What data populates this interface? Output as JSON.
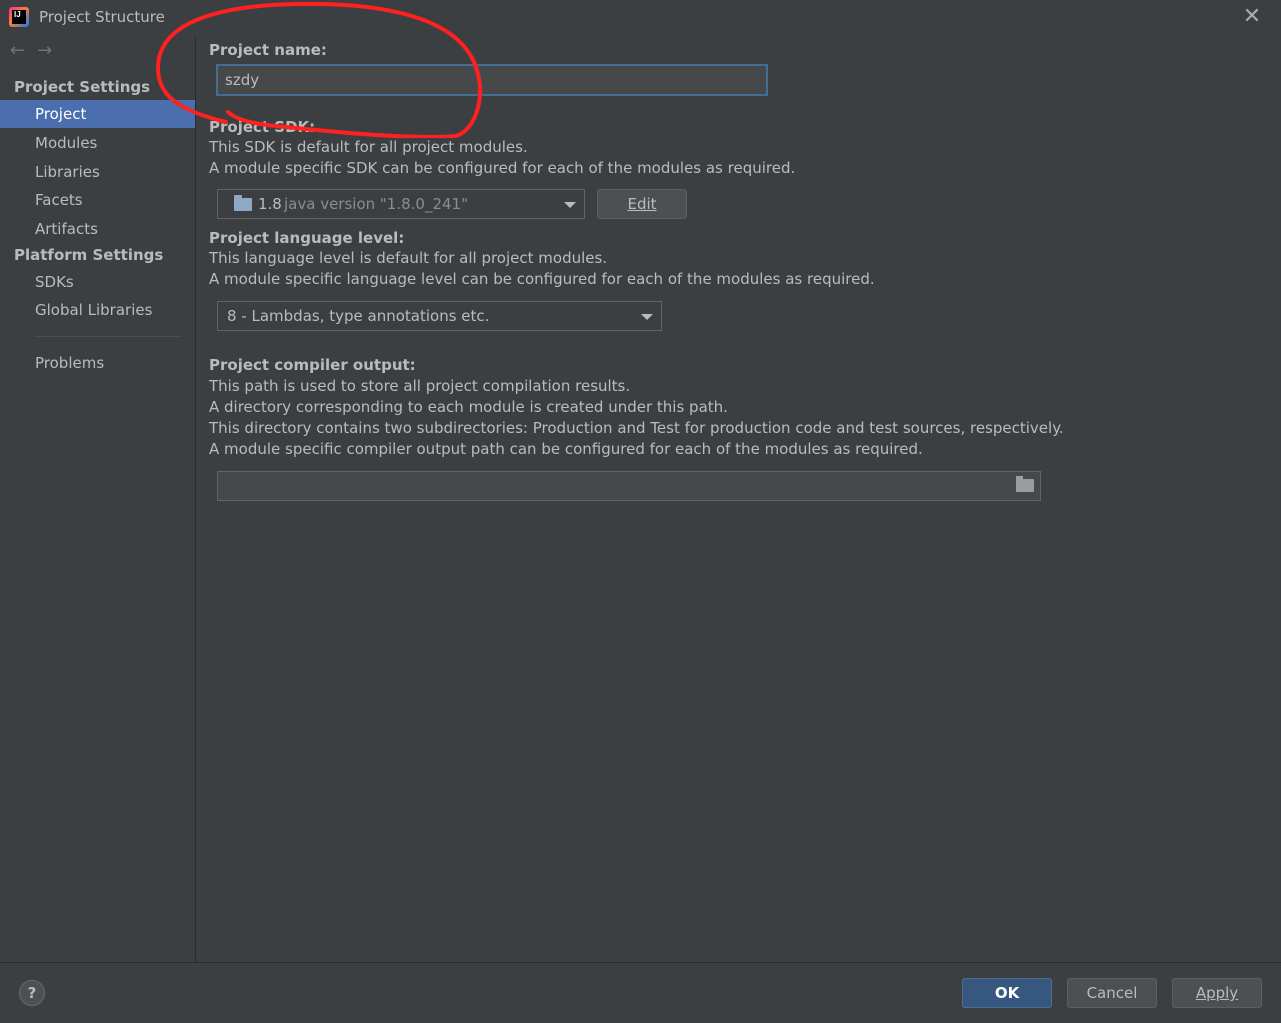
{
  "window": {
    "title": "Project Structure",
    "close_glyph": "✕",
    "app_icon_text": "IJ"
  },
  "nav": {
    "back": "←",
    "forward": "→"
  },
  "sidebar": {
    "project_settings_header": "Project Settings",
    "project_settings_items": [
      "Project",
      "Modules",
      "Libraries",
      "Facets",
      "Artifacts"
    ],
    "platform_settings_header": "Platform Settings",
    "platform_settings_items": [
      "SDKs",
      "Global Libraries"
    ],
    "problems": "Problems",
    "selected": "Project"
  },
  "project": {
    "name_label": "Project name:",
    "name_value": "szdy",
    "sdk_label": "Project SDK:",
    "sdk_desc_1": "This SDK is default for all project modules.",
    "sdk_desc_2": "A module specific SDK can be configured for each of the modules as required.",
    "sdk_version": "1.8",
    "sdk_detail": "java version \"1.8.0_241\"",
    "sdk_edit_button": "Edit",
    "language_label": "Project language level:",
    "language_desc_1": "This language level is default for all project modules.",
    "language_desc_2": "A module specific language level can be configured for each of the modules as required.",
    "language_value": "8 - Lambdas, type annotations etc.",
    "output_label": "Project compiler output:",
    "output_desc_1": "This path is used to store all project compilation results.",
    "output_desc_2": "A directory corresponding to each module is created under this path.",
    "output_desc_3": "This directory contains two subdirectories: Production and Test for production code and test sources, respectively.",
    "output_desc_4": "A module specific compiler output path can be configured for each of the modules as required.",
    "output_path_value": ""
  },
  "footer": {
    "help": "?",
    "ok": "OK",
    "cancel": "Cancel",
    "apply": "Apply"
  },
  "colors": {
    "background": "#3c3f41",
    "selection": "#4b6eaf",
    "annotation": "#ff2020",
    "primary_button": "#365880"
  },
  "icons": [
    "app-icon",
    "close-icon",
    "back-arrow-icon",
    "forward-arrow-icon",
    "folder-icon",
    "browse-folder-icon",
    "help-icon",
    "chevron-down-icon"
  ]
}
